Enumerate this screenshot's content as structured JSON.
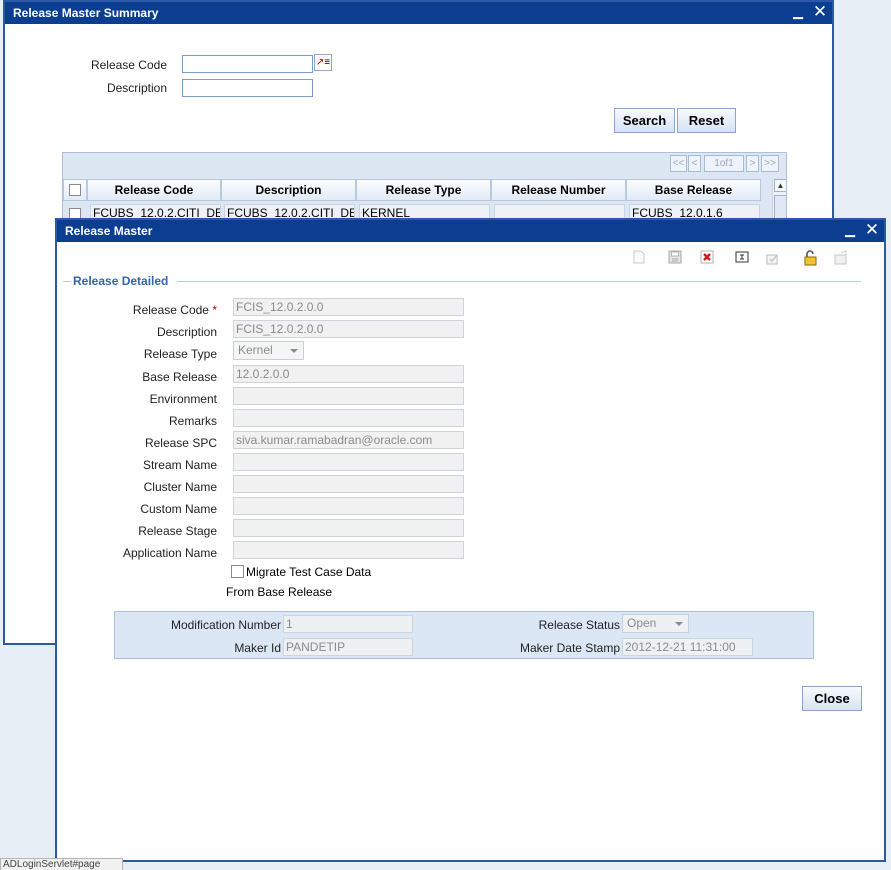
{
  "summary": {
    "title": "Release Master Summary",
    "release_code_label": "Release Code",
    "description_label": "Description",
    "release_code_value": "",
    "description_value": "",
    "search_label": "Search",
    "reset_label": "Reset",
    "pager": {
      "first": "<<",
      "prev": "<",
      "page": "1of1",
      "next": ">",
      "last": ">>"
    },
    "columns": [
      "Release Code",
      "Description",
      "Release Type",
      "Release Number",
      "Base Release"
    ],
    "rows": [
      {
        "release_code": "FCUBS_12.0.2.CITI_DE",
        "description": "FCUBS_12.0.2.CITI_DE",
        "release_type": "KERNEL",
        "release_number": "",
        "base_release": "FCUBS_12.0.1.6"
      }
    ]
  },
  "master": {
    "title": "Release Master",
    "section_title": "Release Detailed",
    "labels": {
      "release_code": "Release Code",
      "description": "Description",
      "release_type": "Release Type",
      "base_release": "Base Release",
      "environment": "Environment",
      "remarks": "Remarks",
      "release_spc": "Release SPC",
      "stream_name": "Stream Name",
      "cluster_name": "Cluster Name",
      "custom_name": "Custom Name",
      "release_stage": "Release Stage",
      "application_name": "Application Name"
    },
    "required_mark": "*",
    "values": {
      "release_code": "FCIS_12.0.2.0.0",
      "description": "FCIS_12.0.2.0.0",
      "release_type": "Kernel",
      "base_release": "12.0.2.0.0",
      "environment": "",
      "remarks": "",
      "release_spc": "siva.kumar.ramabadran@oracle.com",
      "stream_name": "",
      "cluster_name": "",
      "custom_name": "",
      "release_stage": "",
      "application_name": ""
    },
    "migrate_label_line1": "Migrate Test Case Data",
    "migrate_label_line2": "From Base Release",
    "migrate_checked": false,
    "audit": {
      "modification_number_label": "Modification Number",
      "modification_number": "1",
      "maker_id_label": "Maker Id",
      "maker_id": "PANDETIP",
      "release_status_label": "Release Status",
      "release_status": "Open",
      "maker_date_stamp_label": "Maker Date Stamp",
      "maker_date_stamp": "2012-12-21 11:31:00"
    },
    "close_label": "Close",
    "toolbar_icons": [
      "new-icon",
      "save-icon",
      "delete-icon",
      "copy-icon",
      "authorize-icon",
      "unlock-icon",
      "close-record-icon"
    ]
  },
  "statusbar": {
    "text": "ADLoginServlet#page"
  },
  "colors": {
    "titlebar": "#0b3d91",
    "section": "#3564a8",
    "audit_bg": "#dbe7f5",
    "required": "#d00000"
  }
}
